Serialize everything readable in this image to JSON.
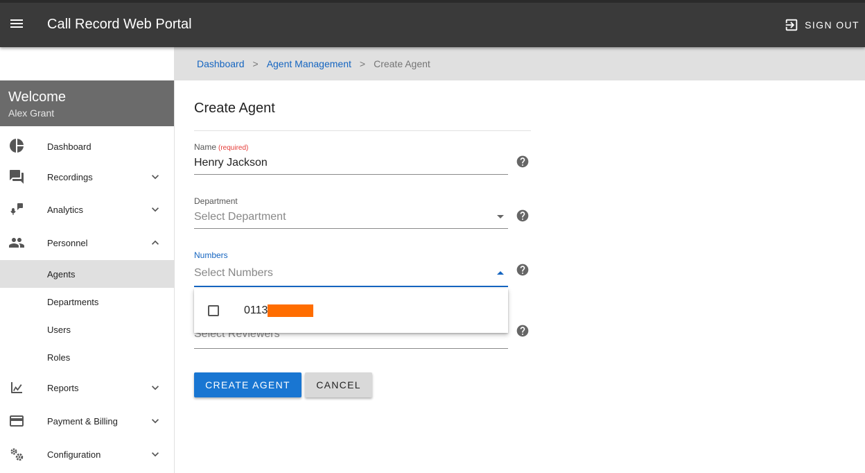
{
  "header": {
    "title": "Call Record Web Portal",
    "signout_label": "SIGN OUT"
  },
  "breadcrumb": {
    "items": [
      "Dashboard",
      "Agent Management"
    ],
    "separator": ">",
    "current": "Create Agent"
  },
  "sidebar": {
    "welcome": "Welcome",
    "user_name": "Alex Grant",
    "items": [
      {
        "label": "Dashboard",
        "icon": "pie-chart-icon"
      },
      {
        "label": "Recordings",
        "icon": "chat-icon"
      },
      {
        "label": "Analytics",
        "icon": "mic-analytics-icon"
      },
      {
        "label": "Personnel",
        "icon": "people-icon"
      },
      {
        "label": "Agents"
      },
      {
        "label": "Departments"
      },
      {
        "label": "Users"
      },
      {
        "label": "Roles"
      },
      {
        "label": "Reports",
        "icon": "chart-icon"
      },
      {
        "label": "Payment & Billing",
        "icon": "credit-card-icon"
      },
      {
        "label": "Configuration",
        "icon": "gears-icon"
      }
    ]
  },
  "form": {
    "title": "Create Agent",
    "name_label": "Name",
    "name_required": "(required)",
    "name_value": "Henry Jackson",
    "department_label": "Department",
    "department_placeholder": "Select Department",
    "numbers_label": "Numbers",
    "numbers_placeholder": "Select Numbers",
    "reviewers_placeholder": "Select Reviewers",
    "numbers_option": "0113",
    "create_button": "CREATE AGENT",
    "cancel_button": "CANCEL"
  },
  "colors": {
    "accent": "#1976d2",
    "topbar": "#3a3a3a",
    "redaction": "#ff6d00"
  }
}
